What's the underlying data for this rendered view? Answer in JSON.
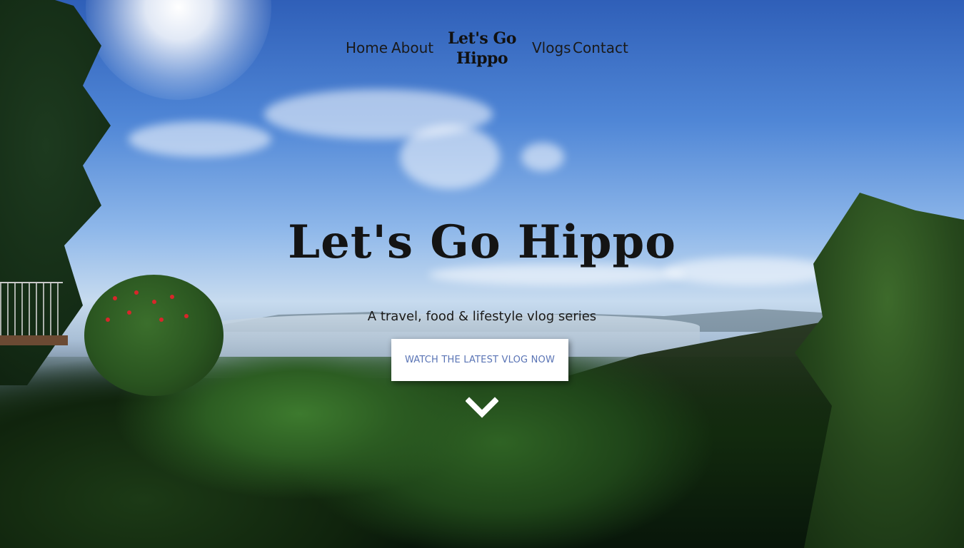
{
  "nav": {
    "home": "Home",
    "about": "About",
    "logo_line1": "Let's Go",
    "logo_line2": "Hippo",
    "vlogs": "Vlogs",
    "contact": "Contact"
  },
  "hero": {
    "title": "Let's Go Hippo",
    "subtitle": "A travel, food & lifestyle vlog series",
    "cta_label": "WATCH THE LATEST VLOG NOW",
    "scroll_icon": "chevron-down-icon"
  },
  "colors": {
    "cta_text": "#5a74b5",
    "cta_background": "#ffffff",
    "nav_text": "#1a1a1a"
  }
}
